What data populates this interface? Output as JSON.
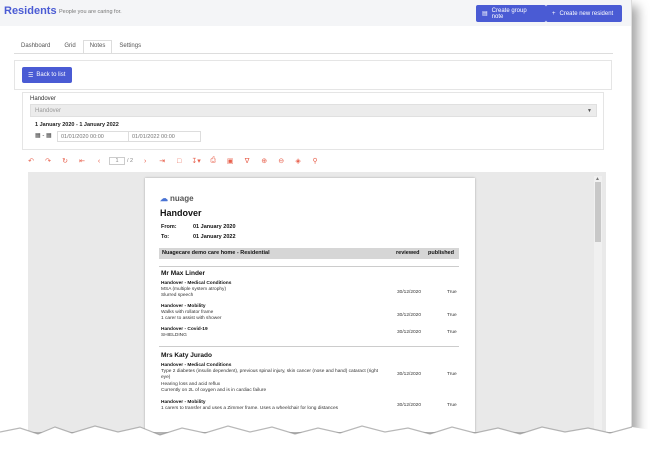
{
  "header": {
    "title": "Residents",
    "subtitle": "People you are caring for.",
    "create_group_note": "Create group note",
    "create_new_resident": "Create new resident"
  },
  "tabs": [
    "Dashboard",
    "Grid",
    "Notes",
    "Settings"
  ],
  "active_tab": "Notes",
  "back_button": "Back to list",
  "filter": {
    "label": "Handover",
    "selected": "Handover",
    "date_range": "1 January 2020 - 1 January 2022",
    "from_value": "01/01/2020 00:00",
    "to_value": "01/01/2022 00:00"
  },
  "toolbar": {
    "page_current": "1",
    "page_total": "/ 2"
  },
  "document": {
    "logo_text": "nuage",
    "title": "Handover",
    "from_label": "From:",
    "from_value": "01 January 2020",
    "to_label": "To:",
    "to_value": "01 January 2022",
    "section": "Nuagecare demo care home - Residential",
    "col_reviewed": "reviewed",
    "col_published": "published",
    "residents": [
      {
        "name": "Mr Max Linder",
        "entries": [
          {
            "heading": "Handover - Medical Conditions",
            "lines": [
              "MSA (multiple system atrophy)",
              "Slurred speech"
            ],
            "reviewed": "30/12/2020",
            "published": "True"
          },
          {
            "heading": "Handover - Mobility",
            "lines": [
              "Walks with rollator frame",
              "1 carer to assist with shower"
            ],
            "reviewed": "30/12/2020",
            "published": "True"
          },
          {
            "heading": "Handover - Covid-19",
            "lines": [
              "SHIELDING"
            ],
            "reviewed": "30/12/2020",
            "published": "True"
          }
        ]
      },
      {
        "name": "Mrs Katy Jurado",
        "entries": [
          {
            "heading": "Handover - Medical Conditions",
            "lines": [
              "Type 2 diabetes (insulin dependent), previous spinal injury, skin cancer (nose and hand) cataract (right",
              "eye)",
              "Hearing loss and acid reflux",
              "Currently on 2L of oxygen and is in cardiac failure"
            ],
            "reviewed": "30/12/2020",
            "published": "True"
          },
          {
            "heading": "Handover - Mobility",
            "lines": [
              "1 carers to transfer and uses a Zimmer frame. Uses a wheelchair for long distances"
            ],
            "reviewed": "30/12/2020",
            "published": "True"
          }
        ]
      }
    ]
  }
}
